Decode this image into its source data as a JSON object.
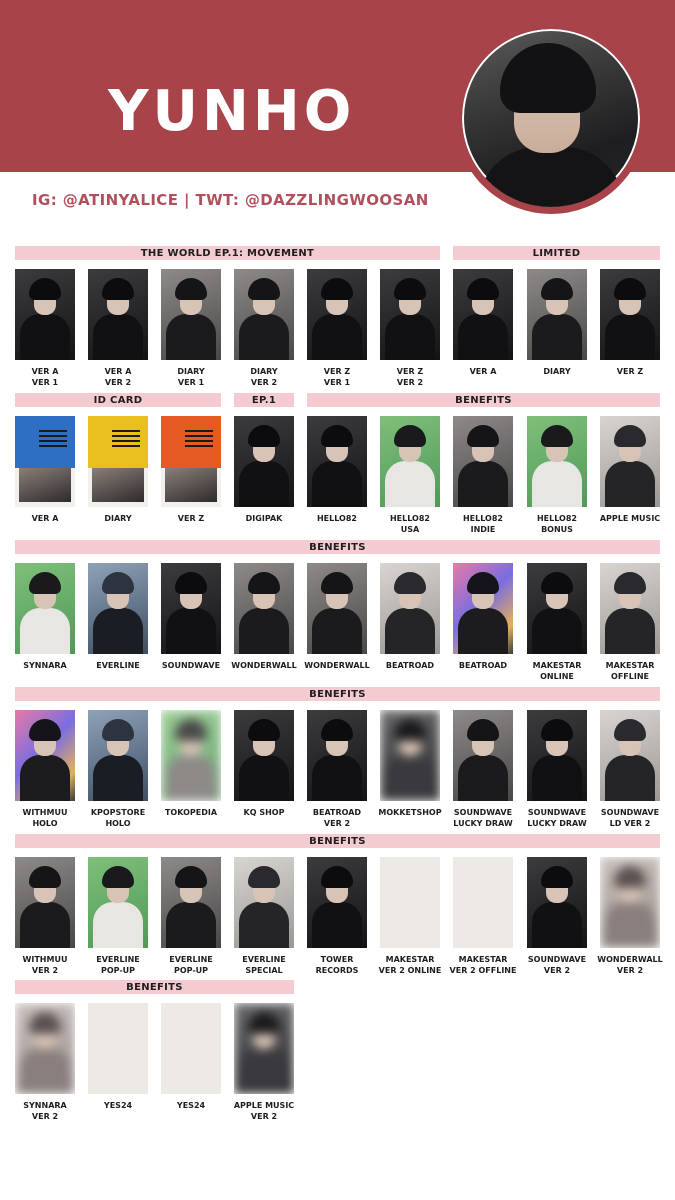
{
  "header": {
    "title": "YUNHO",
    "social": "IG: @ATINYALICE | TWT: @DAZZLINGWOOSAN"
  },
  "colors": {
    "banner": "#a8434a",
    "section_label_bg": "#f3cbd0",
    "social_text": "#b1505c"
  },
  "sections": [
    {
      "label": "THE WORLD EP.1: MOVEMENT"
    },
    {
      "label": "LIMITED"
    },
    {
      "label": "ID CARD"
    },
    {
      "label": "EP.1"
    },
    {
      "label": "BENEFITS"
    },
    {
      "label": "BENEFITS"
    },
    {
      "label": "BENEFITS"
    },
    {
      "label": "BENEFITS"
    },
    {
      "label": "BENEFITS"
    }
  ],
  "cards": [
    {
      "lines": [
        "VER A",
        "VER 1"
      ],
      "style": "dark"
    },
    {
      "lines": [
        "VER A",
        "VER 2"
      ],
      "style": "dark"
    },
    {
      "lines": [
        "DIARY",
        "VER 1"
      ],
      "style": "grey"
    },
    {
      "lines": [
        "DIARY",
        "VER 2"
      ],
      "style": "grey"
    },
    {
      "lines": [
        "VER Z",
        "VER 1"
      ],
      "style": "dark"
    },
    {
      "lines": [
        "VER Z",
        "VER 2"
      ],
      "style": "dark"
    },
    {
      "lines": [
        "VER A"
      ],
      "style": "dark"
    },
    {
      "lines": [
        "DIARY"
      ],
      "style": "grey"
    },
    {
      "lines": [
        "VER Z"
      ],
      "style": "dark"
    },
    {
      "lines": [
        "VER A"
      ],
      "style": "id-blue"
    },
    {
      "lines": [
        "DIARY"
      ],
      "style": "id-yellow"
    },
    {
      "lines": [
        "VER Z"
      ],
      "style": "id-orange"
    },
    {
      "lines": [
        "DIGIPAK"
      ],
      "style": "dark"
    },
    {
      "lines": [
        "HELLO82"
      ],
      "style": "dark"
    },
    {
      "lines": [
        "HELLO82",
        "USA"
      ],
      "style": "green"
    },
    {
      "lines": [
        "HELLO82",
        "INDIE"
      ],
      "style": "grey"
    },
    {
      "lines": [
        "HELLO82",
        "BONUS"
      ],
      "style": "green"
    },
    {
      "lines": [
        "APPLE MUSIC"
      ],
      "style": "light"
    },
    {
      "lines": [
        "SYNNARA"
      ],
      "style": "green"
    },
    {
      "lines": [
        "EVERLINE"
      ],
      "style": "blue"
    },
    {
      "lines": [
        "SOUNDWAVE"
      ],
      "style": "dark"
    },
    {
      "lines": [
        "WONDERWALL"
      ],
      "style": "grey"
    },
    {
      "lines": [
        "WONDERWALL"
      ],
      "style": "grey"
    },
    {
      "lines": [
        "BEATROAD"
      ],
      "style": "light"
    },
    {
      "lines": [
        "BEATROAD"
      ],
      "style": "holo"
    },
    {
      "lines": [
        "MAKESTAR",
        "ONLINE"
      ],
      "style": "dark"
    },
    {
      "lines": [
        "MAKESTAR",
        "OFFLINE"
      ],
      "style": "light"
    },
    {
      "lines": [
        "WITHMUU",
        "HOLO"
      ],
      "style": "holo"
    },
    {
      "lines": [
        "KPOPSTORE",
        "HOLO"
      ],
      "style": "blue"
    },
    {
      "lines": [
        "TOKOPEDIA"
      ],
      "style": "blur-green"
    },
    {
      "lines": [
        "KQ SHOP"
      ],
      "style": "dark"
    },
    {
      "lines": [
        "BEATROAD",
        "VER 2"
      ],
      "style": "dark"
    },
    {
      "lines": [
        "MOKKETSHOP"
      ],
      "style": "blur-dark"
    },
    {
      "lines": [
        "SOUNDWAVE",
        "LUCKY DRAW"
      ],
      "style": "grey"
    },
    {
      "lines": [
        "SOUNDWAVE",
        "LUCKY DRAW"
      ],
      "style": "dark"
    },
    {
      "lines": [
        "SOUNDWAVE",
        "LD VER 2"
      ],
      "style": "light"
    },
    {
      "lines": [
        "WITHMUU",
        "VER 2"
      ],
      "style": "grey"
    },
    {
      "lines": [
        "EVERLINE",
        "POP-UP"
      ],
      "style": "green"
    },
    {
      "lines": [
        "EVERLINE",
        "POP-UP"
      ],
      "style": "grey"
    },
    {
      "lines": [
        "EVERLINE",
        "SPECIAL"
      ],
      "style": "light"
    },
    {
      "lines": [
        "TOWER",
        "RECORDS"
      ],
      "style": "dark"
    },
    {
      "lines": [
        "MAKESTAR",
        "VER 2 ONLINE"
      ],
      "style": "blank"
    },
    {
      "lines": [
        "MAKESTAR",
        "VER 2 OFFLINE"
      ],
      "style": "blank"
    },
    {
      "lines": [
        "SOUNDWAVE",
        "VER 2"
      ],
      "style": "dark"
    },
    {
      "lines": [
        "WONDERWALL",
        "VER 2"
      ],
      "style": "blur-light"
    },
    {
      "lines": [
        "SYNNARA",
        "VER 2"
      ],
      "style": "blur-light"
    },
    {
      "lines": [
        "YES24"
      ],
      "style": "blank"
    },
    {
      "lines": [
        "YES24"
      ],
      "style": "blank"
    },
    {
      "lines": [
        "APPLE MUSIC",
        "VER 2"
      ],
      "style": "blur-dark"
    }
  ]
}
